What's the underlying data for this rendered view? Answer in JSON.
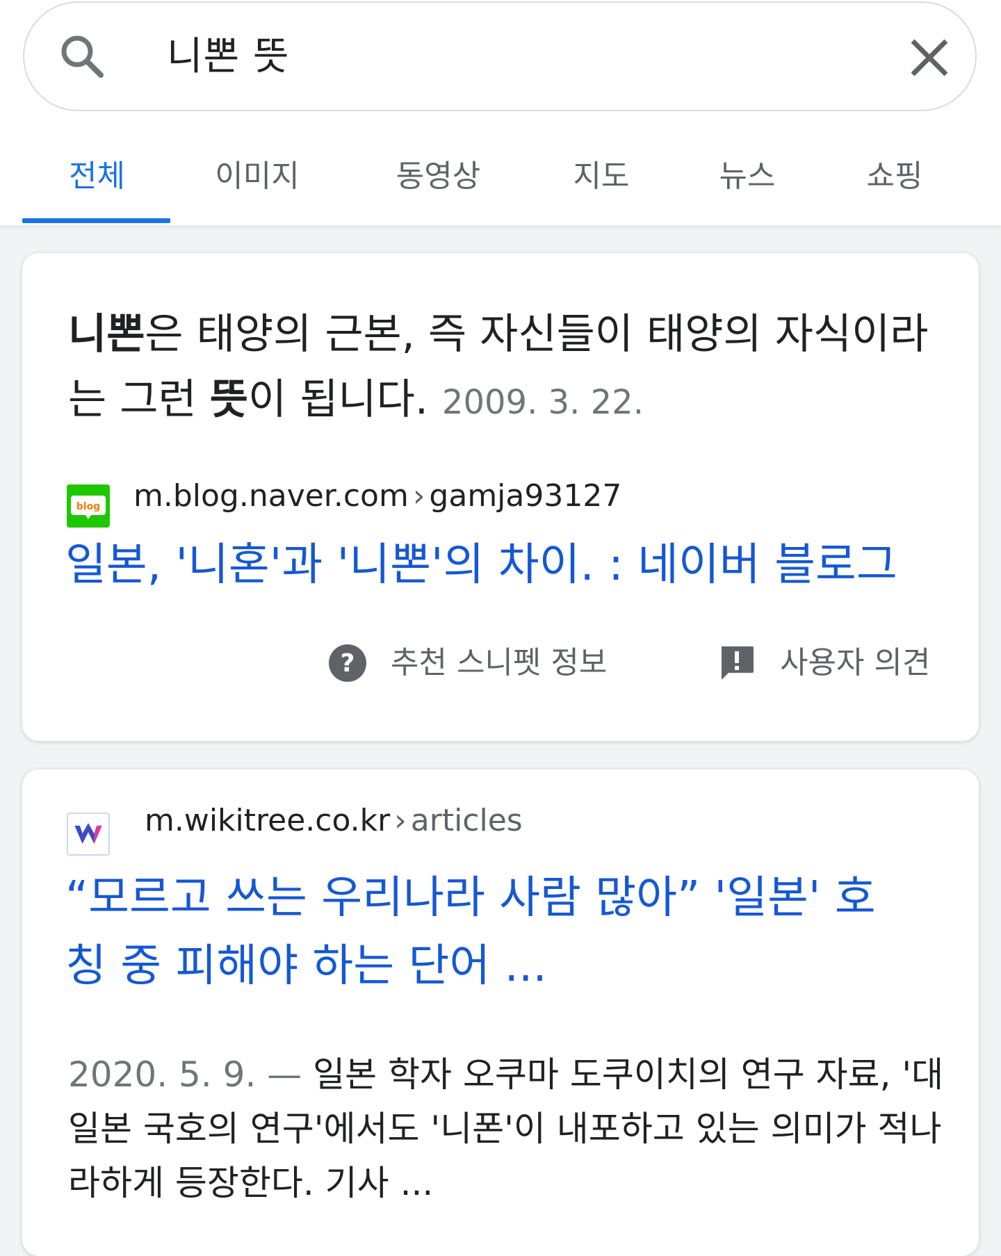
{
  "search": {
    "query": "니뽄 뜻"
  },
  "tabs": [
    {
      "label": "전체",
      "active": true
    },
    {
      "label": "이미지",
      "active": false
    },
    {
      "label": "동영상",
      "active": false
    },
    {
      "label": "지도",
      "active": false
    },
    {
      "label": "뉴스",
      "active": false
    },
    {
      "label": "쇼핑",
      "active": false
    }
  ],
  "featured_snippet": {
    "text_bold": "니뽄",
    "text_1": "은 태양의 근본, 즉 자신들이 태양의 자식이라는 그런 ",
    "text_bold_2": "뜻",
    "text_2": "이 됩니다.",
    "date": "2009. 3. 22.",
    "source": {
      "favicon_icon": "naver-blog-icon",
      "domain": "m.blog.naver.com",
      "path": "gamja93127"
    },
    "title": "일본, '니혼'과 '니뽄'의 차이. : 네이버 블로그",
    "about_label": "추천 스니펫 정보",
    "feedback_label": "사용자 의견"
  },
  "result2": {
    "source": {
      "favicon_icon": "wikitree-icon",
      "domain": "m.wikitree.co.kr",
      "path": "articles"
    },
    "title_line1": "“모르고 쓰는 우리나라 사람 많아” '일본' 호",
    "title_line2": "칭 중 피해야 하는 단어 ...",
    "date": "2020. 5. 9.",
    "dash": " — ",
    "description": "일본 학자 오쿠마 도쿠이치의 연구 자료, '대일본 국호의 연구'에서도 '니폰'이 내포하고 있는 의미가 적나라하게 등장한다. 기사 ..."
  },
  "colors": {
    "accent": "#1a73e8",
    "link": "#1558d6",
    "muted": "#5f6368",
    "naver_green": "#1ec800"
  }
}
